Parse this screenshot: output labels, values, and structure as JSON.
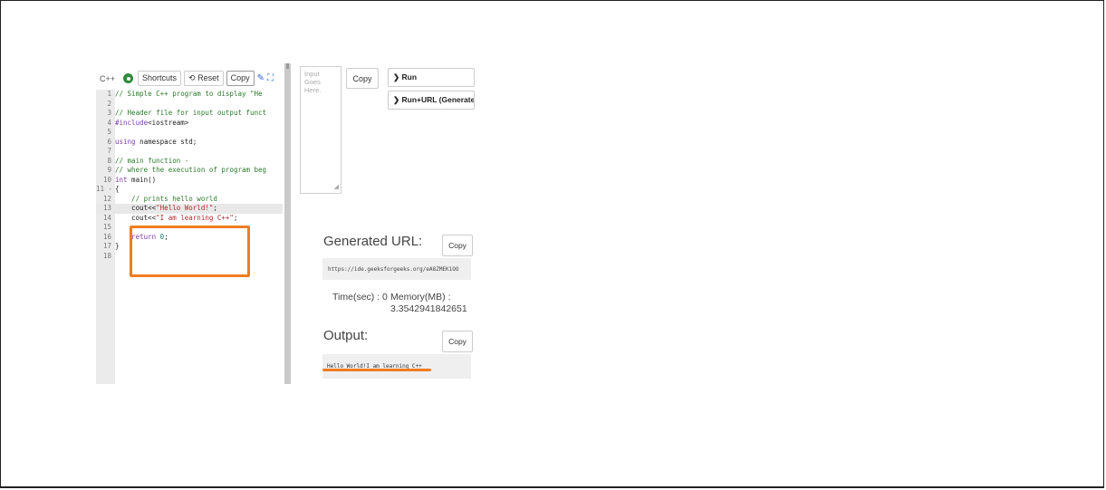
{
  "toolbar": {
    "language": "C++",
    "shortcuts": "Shortcuts",
    "reset": "Reset",
    "copy": "Copy"
  },
  "code_lines": [
    {
      "n": "1",
      "parts": [
        {
          "t": "// Simple C++ program to display \"He",
          "c": "comment"
        }
      ]
    },
    {
      "n": "2",
      "parts": []
    },
    {
      "n": "3",
      "parts": [
        {
          "t": "// Header file for input output funct",
          "c": "comment"
        }
      ]
    },
    {
      "n": "4",
      "parts": [
        {
          "t": "#include",
          "c": "pp"
        },
        {
          "t": "<iostream>",
          "c": ""
        }
      ]
    },
    {
      "n": "5",
      "parts": []
    },
    {
      "n": "6",
      "parts": [
        {
          "t": "using",
          "c": "kw"
        },
        {
          "t": " namespace std;",
          "c": ""
        }
      ]
    },
    {
      "n": "7",
      "parts": []
    },
    {
      "n": "8",
      "parts": [
        {
          "t": "// main function -",
          "c": "comment"
        }
      ]
    },
    {
      "n": "9",
      "parts": [
        {
          "t": "// where the execution of program beg",
          "c": "comment"
        }
      ]
    },
    {
      "n": "10",
      "parts": [
        {
          "t": "int",
          "c": "kw"
        },
        {
          "t": " main()",
          "c": ""
        }
      ]
    },
    {
      "n": "11 -",
      "parts": [
        {
          "t": "{",
          "c": ""
        }
      ]
    },
    {
      "n": "12",
      "parts": [
        {
          "t": "    // prints hello world",
          "c": "comment"
        }
      ]
    },
    {
      "n": "13",
      "parts": [
        {
          "t": "    cout<<",
          "c": ""
        },
        {
          "t": "\"Hello World!\"",
          "c": "str"
        },
        {
          "t": ";",
          "c": ""
        }
      ],
      "active": true
    },
    {
      "n": "14",
      "parts": [
        {
          "t": "    cout<<",
          "c": ""
        },
        {
          "t": "\"I am learning C++\"",
          "c": "str"
        },
        {
          "t": ";",
          "c": ""
        }
      ]
    },
    {
      "n": "15",
      "parts": []
    },
    {
      "n": "16",
      "parts": [
        {
          "t": "    return ",
          "c": "kw"
        },
        {
          "t": "0",
          "c": "num"
        },
        {
          "t": ";",
          "c": ""
        }
      ]
    },
    {
      "n": "17",
      "parts": [
        {
          "t": "}",
          "c": ""
        }
      ]
    },
    {
      "n": "18",
      "parts": []
    }
  ],
  "stdin": {
    "placeholder": "Input Goes Here."
  },
  "stdin_copy": "Copy",
  "run": {
    "run_label": "❯ Run",
    "run_url_label": "❯ Run+URL (Generates U"
  },
  "generated_url": {
    "title": "Generated URL:",
    "copy": "Copy",
    "value": "https://ide.geeksforgeeks.org/eA8ZMEK1OO"
  },
  "metrics": {
    "time": "Time(sec) : 0",
    "memory_label": "Memory(MB) :",
    "memory_value": "3.3542941842651"
  },
  "output": {
    "title": "Output:",
    "copy": "Copy",
    "value": "Hello World!I am learning C++"
  },
  "icons": [
    "run-circle-icon",
    "reset-icon",
    "edit-icon",
    "fullscreen-icon",
    "resize-grip-icon"
  ],
  "colors": {
    "highlight": "#f07c22",
    "run_green": "#2e8b3a"
  }
}
